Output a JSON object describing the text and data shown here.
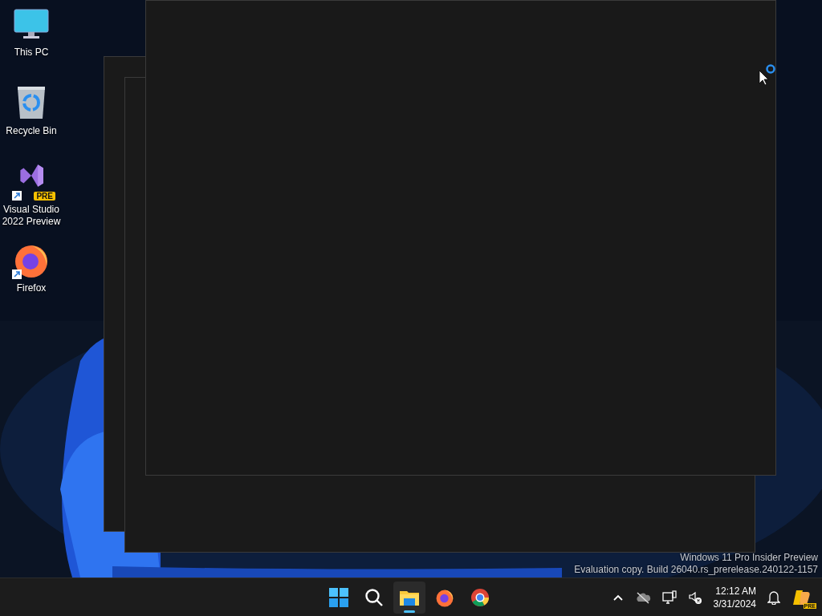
{
  "desktop_icons": [
    {
      "kind": "computer",
      "label": "This PC",
      "shortcut": false
    },
    {
      "kind": "recycle",
      "label": "Recycle Bin",
      "shortcut": false
    },
    {
      "kind": "studio",
      "label": "Visual Studio 2022 Preview",
      "shortcut": true,
      "badge": "PRE"
    },
    {
      "kind": "firefox",
      "label": "Firefox",
      "shortcut": true
    }
  ],
  "watermark": [
    "Windows 11 Pro Insider Preview",
    "Evaluation copy. Build 26040.rs_prerelease.240122-1157"
  ],
  "taskbar": {
    "apps": [
      {
        "kind": "start",
        "selected": false
      },
      {
        "kind": "search",
        "selected": false
      },
      {
        "kind": "explorer",
        "selected": true
      },
      {
        "kind": "firefox",
        "selected": false
      },
      {
        "kind": "chrome",
        "selected": false
      }
    ],
    "tray": [
      {
        "kind": "chevron"
      },
      {
        "kind": "cloud"
      },
      {
        "kind": "network"
      },
      {
        "kind": "volume"
      }
    ],
    "clock": {
      "time": "12:12 AM",
      "date": "3/31/2024"
    },
    "copilot_badge": "PRE"
  }
}
